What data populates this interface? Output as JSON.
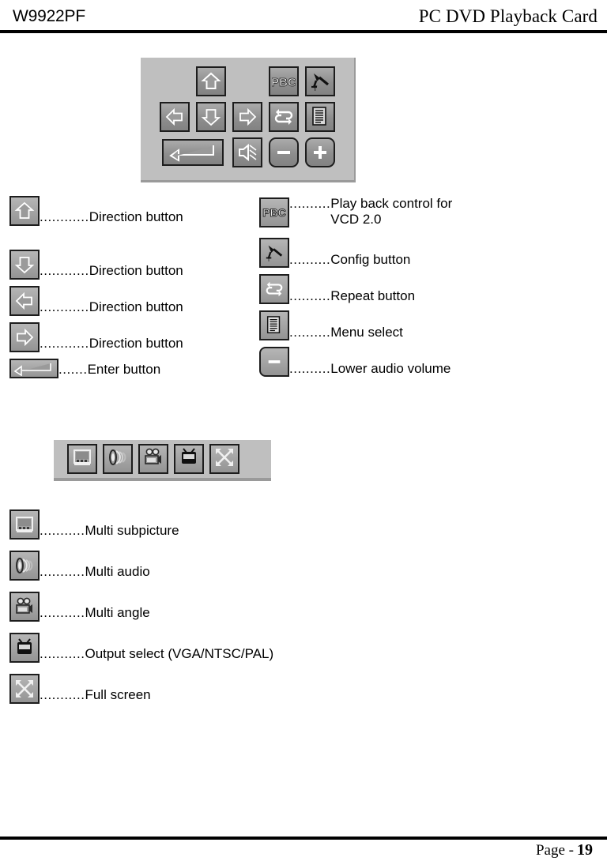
{
  "header": {
    "model": "W9922PF",
    "title": "PC DVD Playback Card"
  },
  "footer": {
    "page_label": "Page -",
    "page_number": "19"
  },
  "colors": {
    "panel_background": "#bfbfbf",
    "button_face_top": "#ababab",
    "button_face_bottom": "#828282",
    "button_border": "#1d1d1d",
    "panel_shadow": "#9a9a9a",
    "text": "#000000"
  },
  "remote_panel": {
    "name": "remote-control-panel",
    "rows": [
      {
        "buttons": [
          {
            "icon": "arrow-up-icon",
            "label": "Direction button up"
          },
          {
            "icon": "pbc-icon",
            "label": "Play back control"
          },
          {
            "icon": "config-tool-icon",
            "label": "Config button"
          }
        ]
      },
      {
        "buttons": [
          {
            "icon": "arrow-left-icon",
            "label": "Direction button left"
          },
          {
            "icon": "arrow-down-icon",
            "label": "Direction button down"
          },
          {
            "icon": "arrow-right-icon",
            "label": "Direction button right"
          },
          {
            "icon": "repeat-icon",
            "label": "Repeat button"
          },
          {
            "icon": "menu-list-icon",
            "label": "Menu select"
          }
        ]
      },
      {
        "buttons": [
          {
            "icon": "enter-return-icon",
            "label": "Enter button"
          },
          {
            "icon": "speaker-mute-icon",
            "label": "Audio / mute"
          },
          {
            "icon": "minus-icon",
            "label": "Lower audio volume"
          },
          {
            "icon": "plus-icon",
            "label": "Raise audio volume"
          }
        ]
      }
    ]
  },
  "legend_left": {
    "leader_default": "............",
    "items": [
      {
        "icon": "arrow-up-icon",
        "leader": "............",
        "text": "Direction button"
      },
      {
        "icon": "arrow-down-icon",
        "leader": "............",
        "text": "Direction button"
      },
      {
        "icon": "arrow-left-icon",
        "leader": "............",
        "text": "Direction button"
      },
      {
        "icon": "arrow-right-icon",
        "leader": "............",
        "text": "Direction button"
      },
      {
        "icon": "enter-return-icon",
        "leader": ".......",
        "text": "Enter button"
      }
    ]
  },
  "legend_right": {
    "items": [
      {
        "icon": "pbc-icon",
        "leader": "..........",
        "text": "Play back control for",
        "text2": "VCD 2.0"
      },
      {
        "icon": "config-tool-icon",
        "leader": "..........",
        "text": "Config button",
        "text2": ""
      },
      {
        "icon": "repeat-icon",
        "leader": "..........",
        "text": "Repeat button",
        "text2": ""
      },
      {
        "icon": "menu-list-icon",
        "leader": "..........",
        "text": "Menu select",
        "text2": ""
      },
      {
        "icon": "minus-icon",
        "leader": "..........",
        "text": "Lower audio volume",
        "text2": ""
      }
    ]
  },
  "feature_toolbar": {
    "name": "feature-toolbar",
    "buttons": [
      {
        "icon": "multi-subpicture-icon",
        "label": "Multi subpicture"
      },
      {
        "icon": "multi-audio-icon",
        "label": "Multi audio"
      },
      {
        "icon": "multi-angle-icon",
        "label": "Multi angle"
      },
      {
        "icon": "output-select-tv-icon",
        "label": "Output select"
      },
      {
        "icon": "full-screen-icon",
        "label": "Full screen"
      }
    ]
  },
  "legend_bottom": {
    "items": [
      {
        "icon": "multi-subpicture-icon",
        "leader": "...........",
        "text": "Multi subpicture"
      },
      {
        "icon": "multi-audio-icon",
        "leader": "...........",
        "text": "Multi audio"
      },
      {
        "icon": "multi-angle-icon",
        "leader": "...........",
        "text": "Multi angle"
      },
      {
        "icon": "output-select-tv-icon",
        "leader": "...........",
        "text": "Output select (VGA/NTSC/PAL)"
      },
      {
        "icon": "full-screen-icon",
        "leader": "...........",
        "text": "Full screen"
      }
    ]
  }
}
